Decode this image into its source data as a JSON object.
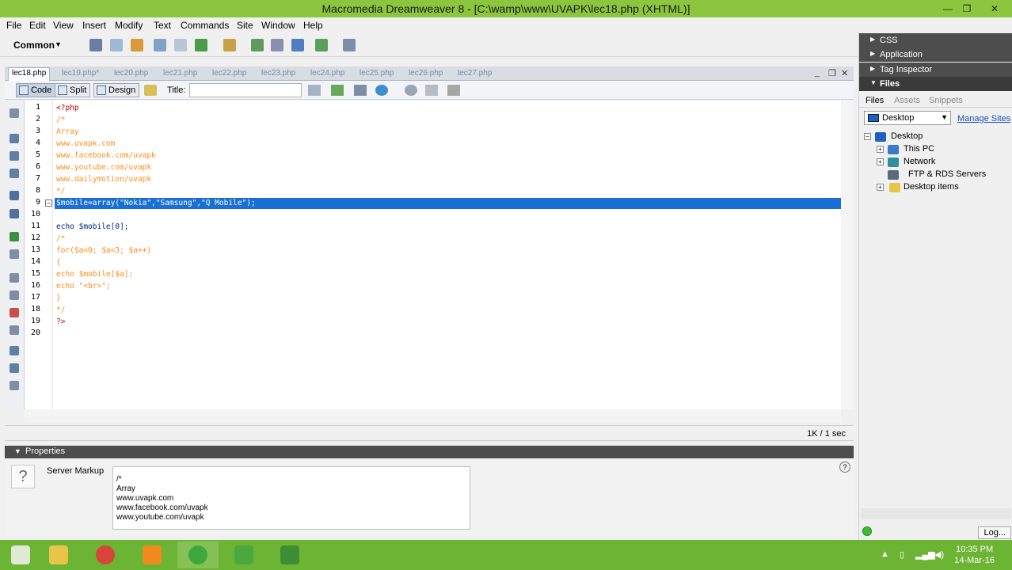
{
  "window": {
    "title": "Macromedia Dreamweaver 8 - [C:\\wamp\\www\\UVAPK\\lec18.php (XHTML)]",
    "minimize_glyph": "—",
    "restore_glyph": "❐",
    "close_glyph": "✕"
  },
  "menu": [
    "File",
    "Edit",
    "View",
    "Insert",
    "Modify",
    "Text",
    "Commands",
    "Site",
    "Window",
    "Help"
  ],
  "insert_bar": {
    "category": "Common",
    "dropdown_glyph": "▼"
  },
  "document_tabs": [
    "lec18.php",
    "lec19.php*",
    "lec20.php",
    "lec21.php",
    "lec22.php",
    "lec23.php",
    "lec24.php",
    "lec25.php",
    "lec26.php",
    "lec27.php"
  ],
  "document_controls": {
    "minimize": "_",
    "restore": "❐",
    "close": "✕"
  },
  "doc_toolbar": {
    "code_label": "Code",
    "split_label": "Split",
    "design_label": "Design",
    "title_label": "Title:",
    "title_value": ""
  },
  "code": {
    "line_numbers": [
      "1",
      "2",
      "3",
      "4",
      "5",
      "6",
      "7",
      "8",
      "9",
      "10",
      "11",
      "12",
      "13",
      "14",
      "15",
      "16",
      "17",
      "18",
      "19",
      "20"
    ],
    "lines": [
      "<?php",
      "/*",
      "Array",
      "www.uvapk.com",
      "www.facebook.com/uvapk",
      "www.youtube.com/uvapk",
      "www.dailymotion/uvapk",
      "*/",
      "$mobile=array(\"Nokia\",\"Samsung\",\"Q Mobile\");",
      "",
      "echo $mobile[0];",
      "/*",
      "for($a=0; $a<3; $a++)",
      "{",
      "echo $mobile[$a];",
      "echo \"<br>\";",
      "}",
      "*/",
      "?>",
      ""
    ],
    "selected_line": 9,
    "fold_glyph": "−"
  },
  "status_bar": {
    "size": "1K / 1 sec"
  },
  "properties": {
    "header": "Properties",
    "label": "Server Markup",
    "help_glyph": "?",
    "unknown_glyph": "?",
    "markup_lines": [
      "/*",
      "Array",
      "www.uvapk.com",
      "www.facebook.com/uvapk",
      "www.youtube.com/uvapk"
    ]
  },
  "right_panel": {
    "panels": [
      "CSS",
      "Application",
      "Tag Inspector",
      "Files"
    ],
    "files_tabs": [
      "Files",
      "Assets",
      "Snippets"
    ],
    "site_select": "Desktop",
    "manage_sites": "Manage Sites",
    "tree": [
      {
        "label": "Desktop",
        "exp": "−"
      },
      {
        "label": "This PC",
        "exp": "+"
      },
      {
        "label": "Network",
        "exp": "+"
      },
      {
        "label": "FTP & RDS Servers",
        "exp": ""
      },
      {
        "label": "Desktop items",
        "exp": "+"
      }
    ],
    "log_button": "Log..."
  },
  "taskbar": {
    "time": "10:35 PM",
    "date": "14-Mar-16"
  },
  "colors": {
    "titlebar": "#8cc63e",
    "taskbar": "#6cb433",
    "selection": "#1a6fd4",
    "php_tag": "#c00000",
    "comment": "#ff8c1a",
    "code": "#002480"
  }
}
